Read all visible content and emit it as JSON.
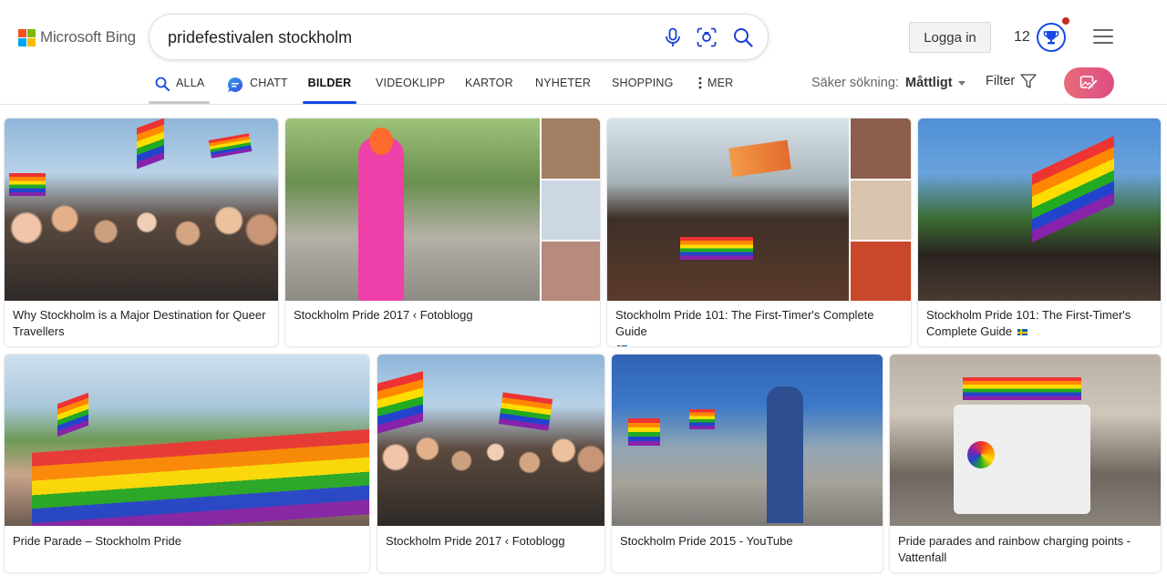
{
  "brand": {
    "name": "Microsoft Bing",
    "colors": [
      "#f25022",
      "#7fba00",
      "#00a4ef",
      "#ffb900"
    ]
  },
  "search": {
    "query": "pridefestivalen stockholm",
    "mic_icon": "microphone-icon",
    "visual_icon": "visual-search-icon",
    "search_icon": "search-icon"
  },
  "account": {
    "login_label": "Logga in",
    "points": "12",
    "reward_icon": "trophy-icon"
  },
  "tabs": [
    {
      "label": "ALLA",
      "icon": "search-icon",
      "active": false
    },
    {
      "label": "CHATT",
      "icon": "chat-icon",
      "active": false
    },
    {
      "label": "BILDER",
      "icon": "",
      "active": true
    },
    {
      "label": "VIDEOKLIPP",
      "icon": "",
      "active": false
    },
    {
      "label": "KARTOR",
      "icon": "",
      "active": false
    },
    {
      "label": "NYHETER",
      "icon": "",
      "active": false
    },
    {
      "label": "SHOPPING",
      "icon": "",
      "active": false
    },
    {
      "label": "MER",
      "icon": "more-vertical-icon",
      "active": false
    }
  ],
  "safe_search": {
    "label": "Säker sökning:",
    "value": "Måttligt"
  },
  "filter_label": "Filter",
  "accent": "#174ae4",
  "results": [
    {
      "caption": "Why Stockholm is a Major Destination for Queer Travellers"
    },
    {
      "caption": "Stockholm Pride 2017 ‹ Fotoblogg"
    },
    {
      "caption": "Stockholm Pride 101: The First-Timer's Complete Guide"
    },
    {
      "caption": "Stockholm Pride 101: The First-Timer's Complete Guide"
    },
    {
      "caption": "Pride Parade – Stockholm Pride"
    },
    {
      "caption": "Stockholm Pride 2017 ‹ Fotoblogg"
    },
    {
      "caption": "Stockholm Pride 2015 - YouTube"
    },
    {
      "caption": "Pride parades and rainbow charging points - Vattenfall"
    }
  ]
}
